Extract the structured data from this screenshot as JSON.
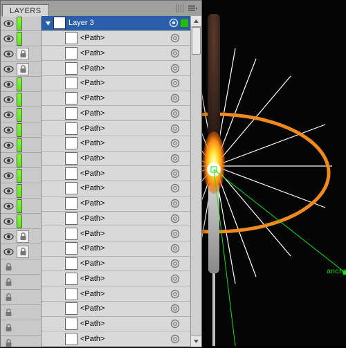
{
  "panel": {
    "tab_label": "LAYERS",
    "top_layer_name": "Layer 3",
    "sub_item_label": "<Path>",
    "sub_item_count": 21
  },
  "thumb_rows": [
    {
      "kind": "eye",
      "accent": "green"
    },
    {
      "kind": "eye",
      "accent": "green"
    },
    {
      "kind": "eye",
      "accent": "lock"
    },
    {
      "kind": "eye",
      "accent": "lock"
    },
    {
      "kind": "eye",
      "accent": "green"
    },
    {
      "kind": "eye",
      "accent": "green"
    },
    {
      "kind": "eye",
      "accent": "green"
    },
    {
      "kind": "eye",
      "accent": "green"
    },
    {
      "kind": "eye",
      "accent": "green"
    },
    {
      "kind": "eye",
      "accent": "green"
    },
    {
      "kind": "eye",
      "accent": "green"
    },
    {
      "kind": "eye",
      "accent": "green"
    },
    {
      "kind": "eye",
      "accent": "green"
    },
    {
      "kind": "eye",
      "accent": "green"
    },
    {
      "kind": "eye",
      "accent": "lock"
    },
    {
      "kind": "eye",
      "accent": "lock"
    },
    {
      "kind": "lock",
      "accent": "none"
    },
    {
      "kind": "lock",
      "accent": "none"
    },
    {
      "kind": "lock",
      "accent": "none"
    },
    {
      "kind": "lock",
      "accent": "none"
    },
    {
      "kind": "lock",
      "accent": "none"
    },
    {
      "kind": "lock",
      "accent": "none"
    }
  ],
  "canvas": {
    "anchor_label": "anchor",
    "colors": {
      "ring": "#f08a1e",
      "guide": "#19e019",
      "ray": "#ffffff"
    }
  }
}
